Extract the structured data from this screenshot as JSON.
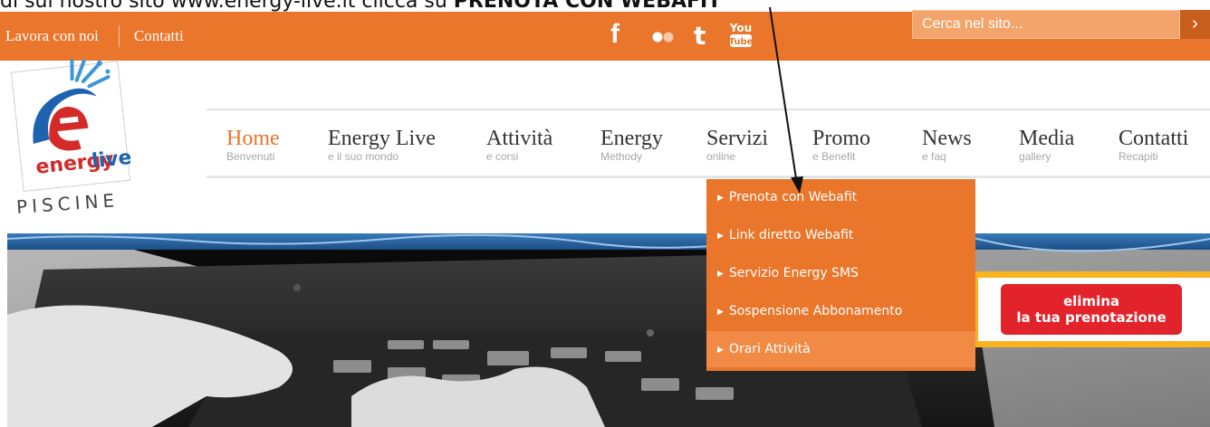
{
  "instruction": {
    "prefix": "di sul nostro sito www.energy-live.it clicca su ",
    "bold": "PRENOTA CON WEBAFIT"
  },
  "topbar": {
    "links": [
      "Lavora con noi",
      "Contatti"
    ],
    "social_icons": [
      "facebook-icon",
      "flickr-icon",
      "tumblr-icon",
      "youtube-icon"
    ],
    "search_placeholder": "Cerca nel sito...",
    "search_button": "›"
  },
  "logo": {
    "brand": "energy",
    "brand2": "live",
    "sub": "PISCINE"
  },
  "nav": [
    {
      "title": "Home",
      "sub": "Benvenuti"
    },
    {
      "title": "Energy Live",
      "sub": "e il suo mondo"
    },
    {
      "title": "Attività",
      "sub": "e corsi"
    },
    {
      "title": "Energy",
      "sub": "Methody"
    },
    {
      "title": "Servizi",
      "sub": "online"
    },
    {
      "title": "Promo",
      "sub": "e Benefit"
    },
    {
      "title": "News",
      "sub": "e faq"
    },
    {
      "title": "Media",
      "sub": "gallery"
    },
    {
      "title": "Contatti",
      "sub": "Recapiti"
    }
  ],
  "dropdown": [
    "Prenota con Webafit",
    "Link diretto Webafit",
    "Servizio Energy SMS",
    "Sospensione Abbonamento",
    "Orari Attività"
  ],
  "banner": {
    "line1": "elimina",
    "line2": "la tua prenotazione"
  },
  "colors": {
    "orange": "#e9762b",
    "banner_red": "#e3232b",
    "banner_yellow": "#f7b320"
  }
}
